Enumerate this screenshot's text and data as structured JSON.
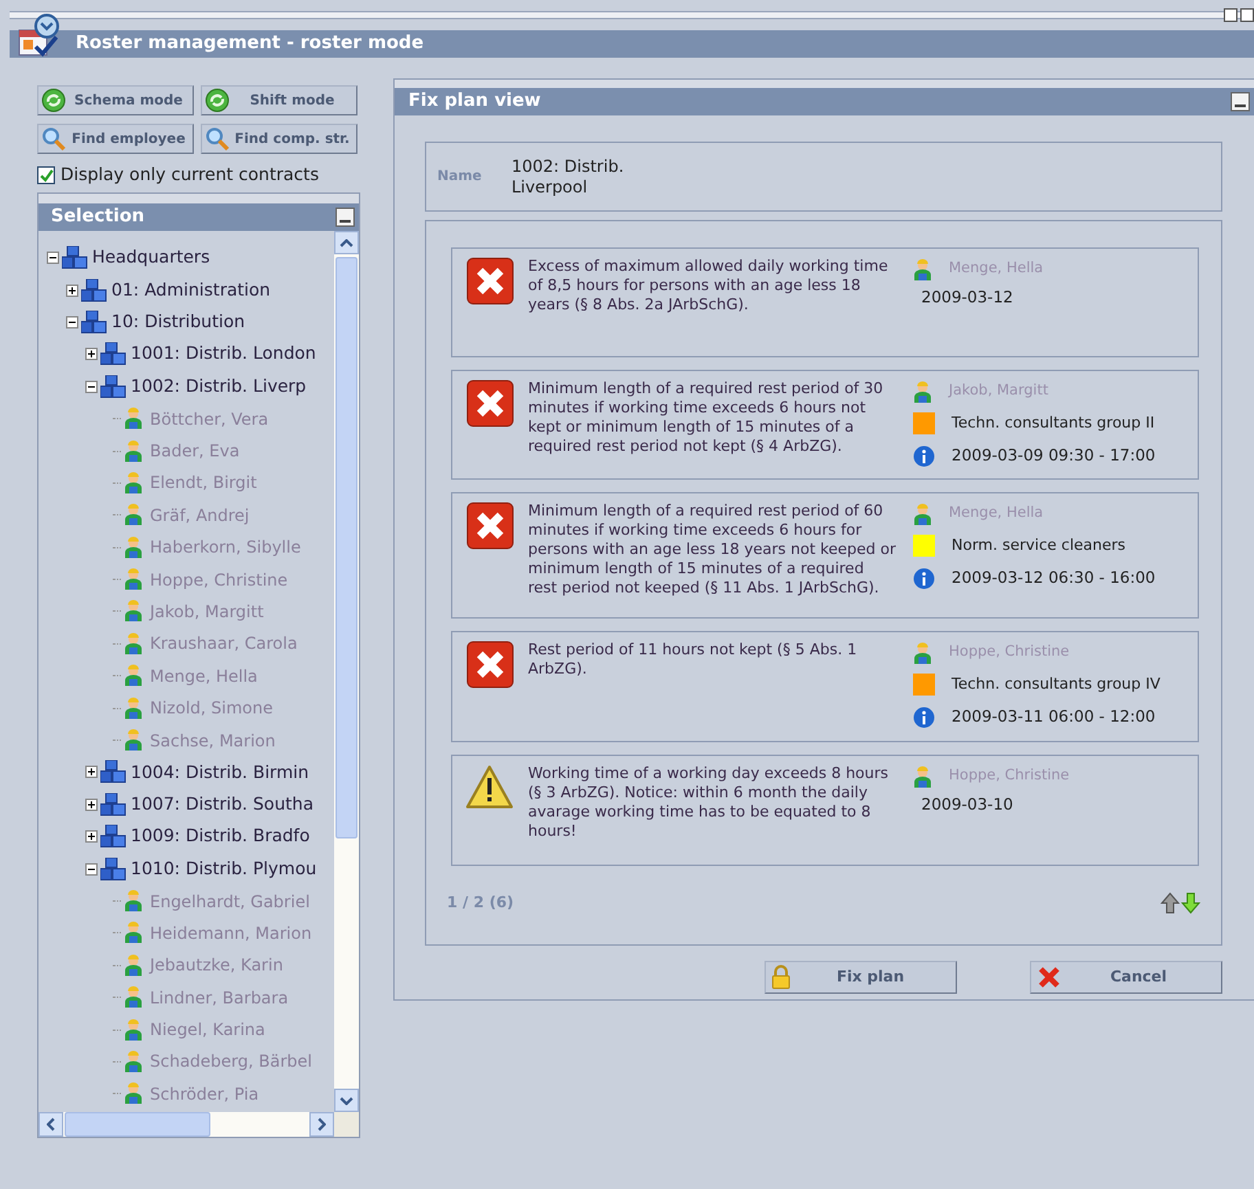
{
  "window": {
    "title": "Roster management - roster mode"
  },
  "toolbar": [
    {
      "label": "Schema mode"
    },
    {
      "label": "Shift mode"
    },
    {
      "label": "Find employee"
    },
    {
      "label": "Find comp. str."
    }
  ],
  "current_contracts": {
    "label": "Display only current contracts",
    "checked": true
  },
  "selection": {
    "title": "Selection",
    "tree": [
      {
        "kind": "unit",
        "label": "Headquarters",
        "expanded": true,
        "children": [
          {
            "kind": "unit",
            "label": "01: Administration",
            "expanded": false
          },
          {
            "kind": "unit",
            "label": "10: Distribution",
            "expanded": true,
            "children": [
              {
                "kind": "unit",
                "label": "1001: Distrib. London",
                "expanded": false
              },
              {
                "kind": "unit",
                "label": "1002: Distrib. Liverp",
                "expanded": true,
                "children": [
                  {
                    "kind": "person",
                    "label": "Böttcher, Vera"
                  },
                  {
                    "kind": "person",
                    "label": "Bader, Eva"
                  },
                  {
                    "kind": "person",
                    "label": "Elendt, Birgit"
                  },
                  {
                    "kind": "person",
                    "label": "Gräf, Andrej"
                  },
                  {
                    "kind": "person",
                    "label": "Haberkorn, Sibylle"
                  },
                  {
                    "kind": "person",
                    "label": "Hoppe, Christine"
                  },
                  {
                    "kind": "person",
                    "label": "Jakob, Margitt"
                  },
                  {
                    "kind": "person",
                    "label": "Kraushaar, Carola"
                  },
                  {
                    "kind": "person",
                    "label": "Menge, Hella"
                  },
                  {
                    "kind": "person",
                    "label": "Nizold, Simone"
                  },
                  {
                    "kind": "person",
                    "label": "Sachse, Marion"
                  }
                ]
              },
              {
                "kind": "unit",
                "label": "1004: Distrib. Birmin",
                "expanded": false
              },
              {
                "kind": "unit",
                "label": "1007: Distrib. Southa",
                "expanded": false
              },
              {
                "kind": "unit",
                "label": "1009: Distrib. Bradfo",
                "expanded": false
              },
              {
                "kind": "unit",
                "label": "1010: Distrib. Plymou",
                "expanded": true,
                "children": [
                  {
                    "kind": "person",
                    "label": "Engelhardt, Gabriel"
                  },
                  {
                    "kind": "person",
                    "label": "Heidemann, Marion"
                  },
                  {
                    "kind": "person",
                    "label": "Jebautzke, Karin"
                  },
                  {
                    "kind": "person",
                    "label": "Lindner, Barbara"
                  },
                  {
                    "kind": "person",
                    "label": "Niegel, Karina"
                  },
                  {
                    "kind": "person",
                    "label": "Schadeberg, Bärbel"
                  },
                  {
                    "kind": "person",
                    "label": "Schröder, Pia"
                  }
                ]
              }
            ]
          }
        ]
      }
    ]
  },
  "fix_plan": {
    "title": "Fix plan view",
    "name_label": "Name",
    "name_value": "1002: Distrib.\nLiverpool",
    "violations": [
      {
        "kind": "error",
        "text": "Excess of maximum allowed daily working time of 8,5 hours for persons with an age less 18 years (§ 8 Abs. 2a JArbSchG).",
        "person": "Menge, Hella",
        "date": "2009-03-12",
        "info": false
      },
      {
        "kind": "error",
        "text": "Minimum length of a required rest period of 30 minutes if working time exceeds 6 hours not kept or minimum length of 15 minutes of a required rest period not kept (§ 4 ArbZG).",
        "person": "Jakob, Margitt",
        "group": {
          "label": "Techn. consultants group II",
          "color": "#ff9900"
        },
        "date": "2009-03-09 09:30 - 17:00",
        "info": true
      },
      {
        "kind": "error",
        "text": "Minimum length of a required rest period of 60 minutes if working time exceeds 6 hours for persons with an age less 18 years not keeped or minimum length of 15 minutes of a required rest period not keeped (§ 11 Abs. 1 JArbSchG).",
        "person": "Menge, Hella",
        "group": {
          "label": "Norm. service cleaners",
          "color": "#ffff00"
        },
        "date": "2009-03-12 06:30 - 16:00",
        "info": true
      },
      {
        "kind": "error",
        "text": "Rest period of 11 hours not kept (§ 5 Abs. 1 ArbZG).",
        "person": "Hoppe, Christine",
        "group": {
          "label": "Techn. consultants group IV",
          "color": "#ff9900"
        },
        "date": "2009-03-11 06:00 - 12:00",
        "info": true
      },
      {
        "kind": "warning",
        "text": "Working time of a working day exceeds 8 hours (§ 3 ArbZG). Notice: within 6 month the daily avarage working time has to be equated to 8 hours!",
        "person": "Hoppe, Christine",
        "date": "2009-03-10",
        "info": false
      }
    ],
    "pager": "1 / 2 (6)",
    "buttons": [
      {
        "label": "Fix plan"
      },
      {
        "label": "Cancel"
      }
    ]
  }
}
